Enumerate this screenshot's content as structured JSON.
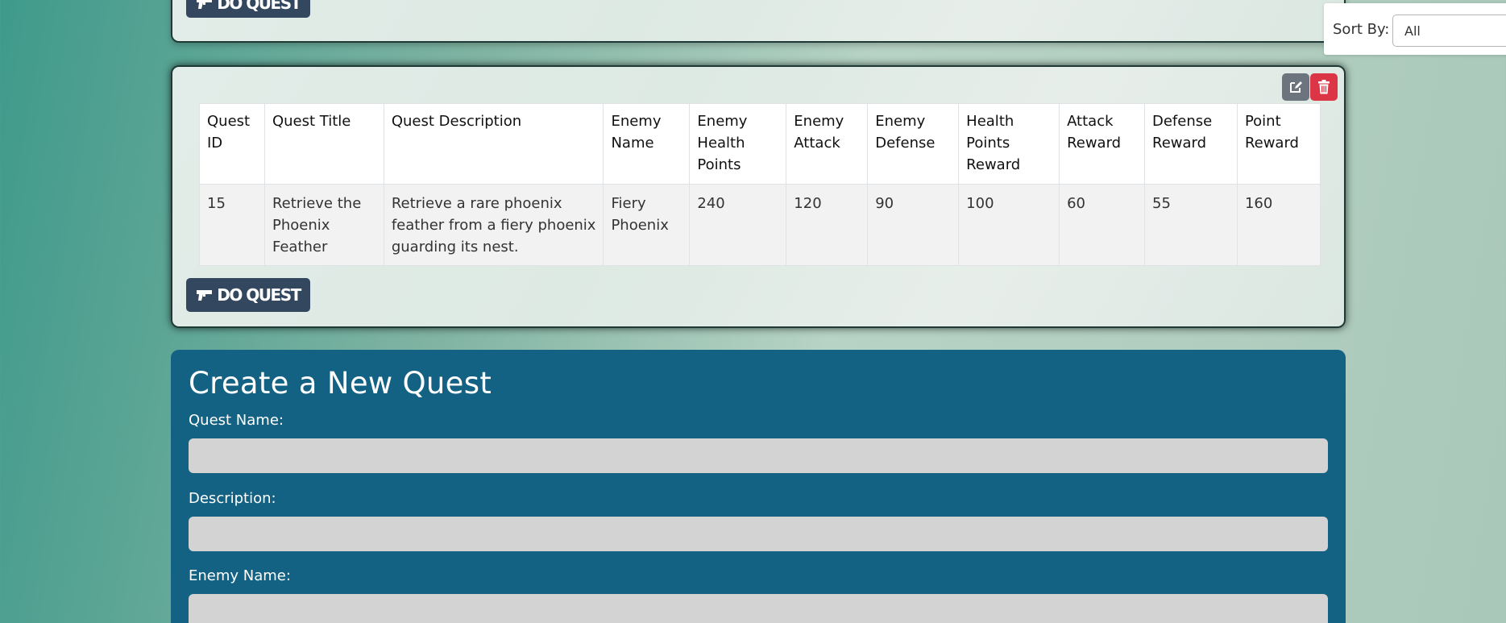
{
  "sort": {
    "label": "Sort By:",
    "selected": "All"
  },
  "do_quest_label": "DO QUEST",
  "table": {
    "headers": [
      "Quest ID",
      "Quest Title",
      "Quest Description",
      "Enemy Name",
      "Enemy Health Points",
      "Enemy Attack",
      "Enemy Defense",
      "Health Points Reward",
      "Attack Reward",
      "Defense Reward",
      "Point Reward"
    ],
    "row": {
      "quest_id": "15",
      "quest_title": "Retrieve the Phoenix Feather",
      "quest_description": "Retrieve a rare phoenix feather from a fiery phoenix guarding its nest.",
      "enemy_name": "Fiery Phoenix",
      "enemy_health": "240",
      "enemy_attack": "120",
      "enemy_defense": "90",
      "health_reward": "100",
      "attack_reward": "60",
      "defense_reward": "55",
      "point_reward": "160"
    }
  },
  "create_form": {
    "title": "Create a New Quest",
    "quest_name_label": "Quest Name:",
    "description_label": "Description:",
    "enemy_name_label": "Enemy Name:"
  },
  "icons": {
    "do_quest": "gun-icon",
    "edit": "edit-icon",
    "delete": "trash-icon"
  },
  "colors": {
    "enemy_stat": "#c8304a",
    "reward_stat": "#2e7d32",
    "form_bg": "#146283",
    "do_quest_bg": "#33475e",
    "delete_bg": "#dc3545",
    "edit_bg": "#6c757d"
  }
}
